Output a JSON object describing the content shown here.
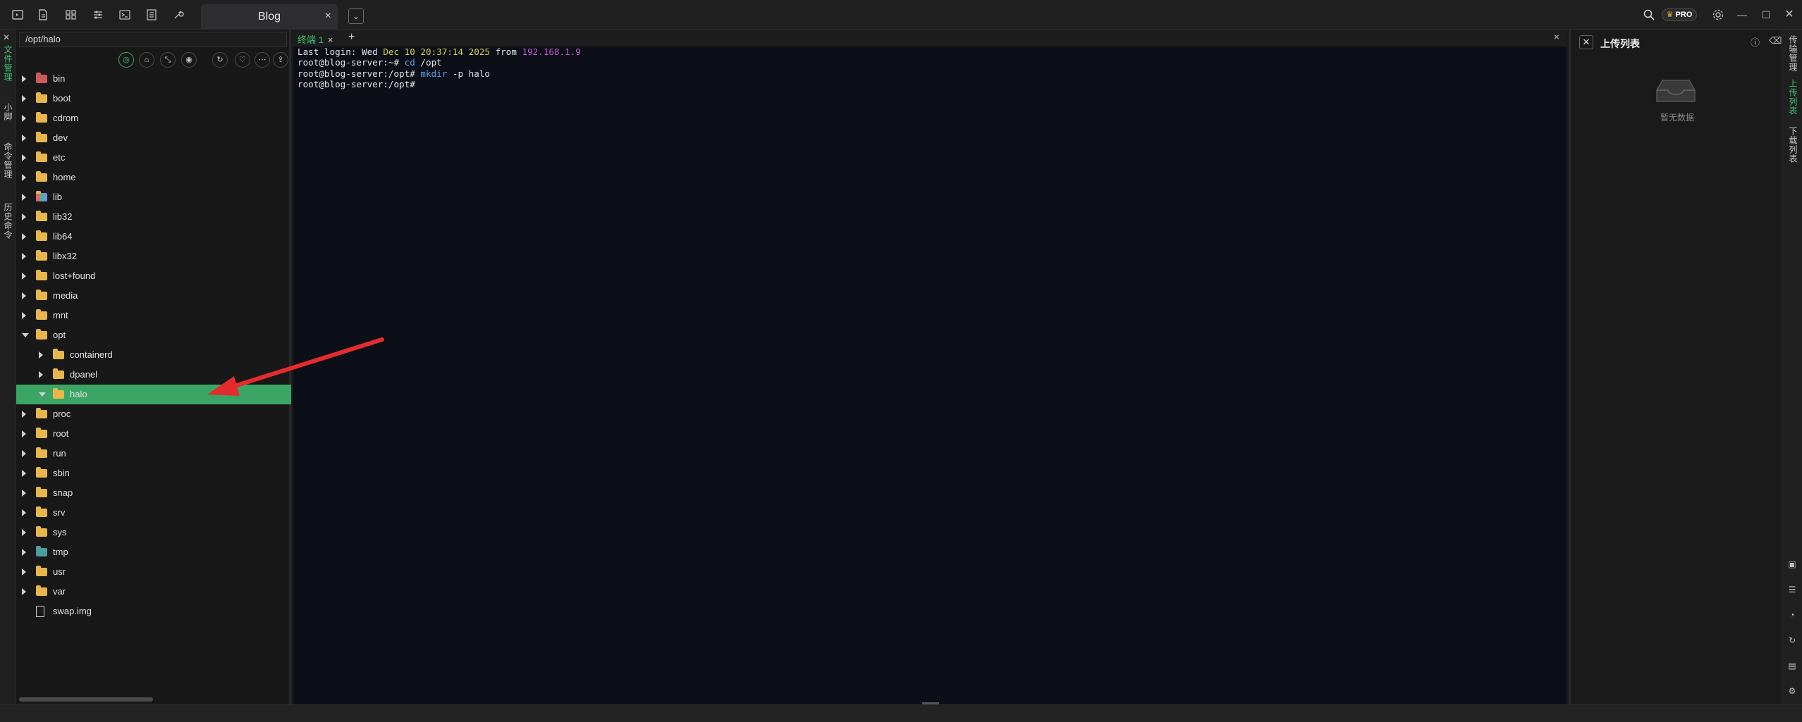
{
  "topbar": {
    "tab_title": "Blog",
    "tab_close": "×",
    "dropdown": "⌄",
    "pro_label": "PRO",
    "minimize": "—",
    "maximize": "☐",
    "close": "✕"
  },
  "left_rail": {
    "close": "✕",
    "items": [
      "文件管理",
      "小脚",
      "命令管理",
      "历史命令"
    ]
  },
  "file_pane": {
    "path": "/opt/halo",
    "tree": [
      {
        "name": "bin",
        "depth": 0,
        "expanded": false,
        "type": "folder-red"
      },
      {
        "name": "boot",
        "depth": 0,
        "expanded": false,
        "type": "folder"
      },
      {
        "name": "cdrom",
        "depth": 0,
        "expanded": false,
        "type": "folder"
      },
      {
        "name": "dev",
        "depth": 0,
        "expanded": false,
        "type": "folder"
      },
      {
        "name": "etc",
        "depth": 0,
        "expanded": false,
        "type": "folder"
      },
      {
        "name": "home",
        "depth": 0,
        "expanded": false,
        "type": "folder"
      },
      {
        "name": "lib",
        "depth": 0,
        "expanded": false,
        "type": "folder-multi"
      },
      {
        "name": "lib32",
        "depth": 0,
        "expanded": false,
        "type": "folder"
      },
      {
        "name": "lib64",
        "depth": 0,
        "expanded": false,
        "type": "folder"
      },
      {
        "name": "libx32",
        "depth": 0,
        "expanded": false,
        "type": "folder"
      },
      {
        "name": "lost+found",
        "depth": 0,
        "expanded": false,
        "type": "folder"
      },
      {
        "name": "media",
        "depth": 0,
        "expanded": false,
        "type": "folder"
      },
      {
        "name": "mnt",
        "depth": 0,
        "expanded": false,
        "type": "folder"
      },
      {
        "name": "opt",
        "depth": 0,
        "expanded": true,
        "type": "folder"
      },
      {
        "name": "containerd",
        "depth": 1,
        "expanded": false,
        "type": "folder"
      },
      {
        "name": "dpanel",
        "depth": 1,
        "expanded": false,
        "type": "folder"
      },
      {
        "name": "halo",
        "depth": 1,
        "expanded": true,
        "type": "folder",
        "selected": true
      },
      {
        "name": "proc",
        "depth": 0,
        "expanded": false,
        "type": "folder"
      },
      {
        "name": "root",
        "depth": 0,
        "expanded": false,
        "type": "folder"
      },
      {
        "name": "run",
        "depth": 0,
        "expanded": false,
        "type": "folder"
      },
      {
        "name": "sbin",
        "depth": 0,
        "expanded": false,
        "type": "folder"
      },
      {
        "name": "snap",
        "depth": 0,
        "expanded": false,
        "type": "folder"
      },
      {
        "name": "srv",
        "depth": 0,
        "expanded": false,
        "type": "folder"
      },
      {
        "name": "sys",
        "depth": 0,
        "expanded": false,
        "type": "folder"
      },
      {
        "name": "tmp",
        "depth": 0,
        "expanded": false,
        "type": "folder-teal"
      },
      {
        "name": "usr",
        "depth": 0,
        "expanded": false,
        "type": "folder"
      },
      {
        "name": "var",
        "depth": 0,
        "expanded": false,
        "type": "folder"
      },
      {
        "name": "swap.img",
        "depth": 0,
        "expanded": null,
        "type": "file"
      }
    ]
  },
  "terminal": {
    "tab_label": "终端 1",
    "tab_close": "×",
    "add": "+",
    "close": "×",
    "lines": [
      [
        {
          "t": "Last login: Wed ",
          "c": ""
        },
        {
          "t": "Dec 10 20:37:14 2025",
          "c": "c-date"
        },
        {
          "t": " from ",
          "c": ""
        },
        {
          "t": "192.168.1.9",
          "c": "c-ip"
        }
      ],
      [
        {
          "t": "root@blog-server:~# ",
          "c": ""
        },
        {
          "t": "cd",
          "c": "c-cmd"
        },
        {
          "t": " /opt",
          "c": ""
        }
      ],
      [
        {
          "t": "root@blog-server:/opt# ",
          "c": ""
        },
        {
          "t": "mkdir",
          "c": "c-cmd"
        },
        {
          "t": " -p halo",
          "c": ""
        }
      ],
      [
        {
          "t": "root@blog-server:/opt# ",
          "c": ""
        }
      ]
    ]
  },
  "upload_pane": {
    "close": "✕",
    "title": "上传列表",
    "empty_text": "暂无数据"
  },
  "right_rail": {
    "items": [
      "传输管理",
      "上传列表",
      "下载列表"
    ]
  },
  "colors": {
    "selection": "#3aa565",
    "accent": "#3fbf6a",
    "arrow": "#e52c2c"
  }
}
